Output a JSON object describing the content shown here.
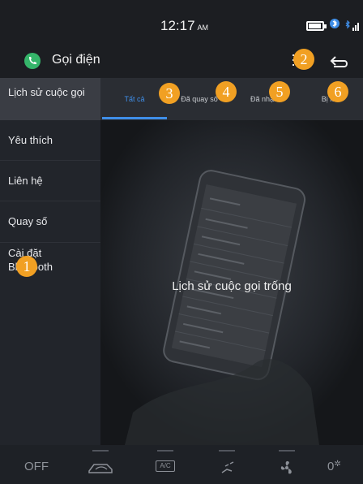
{
  "status_bar": {
    "time": "12:17",
    "ampm": "AM"
  },
  "app": {
    "title": "Gọi điện"
  },
  "sidebar": {
    "items": [
      {
        "label": "Lịch sử cuộc gọi"
      },
      {
        "label": "Yêu thích"
      },
      {
        "label": "Liên hệ"
      },
      {
        "label": "Quay số"
      },
      {
        "label": "Cài đặt Bluetooth"
      }
    ]
  },
  "tabs": [
    {
      "label": "Tất cả"
    },
    {
      "label": "Đã quay số"
    },
    {
      "label": "Đã nhận"
    },
    {
      "label": "Bị lỡ"
    }
  ],
  "main": {
    "empty_message": "Lịch sử cuộc gọi trống"
  },
  "bottom_bar": {
    "off_label": "OFF",
    "ac_label": "A/C",
    "fan_speed": "0"
  },
  "annotations": [
    "1",
    "2",
    "3",
    "4",
    "5",
    "6"
  ],
  "colors": {
    "accent": "#3f8ee8",
    "badge": "#f1a023",
    "phone_green": "#35b56a"
  }
}
